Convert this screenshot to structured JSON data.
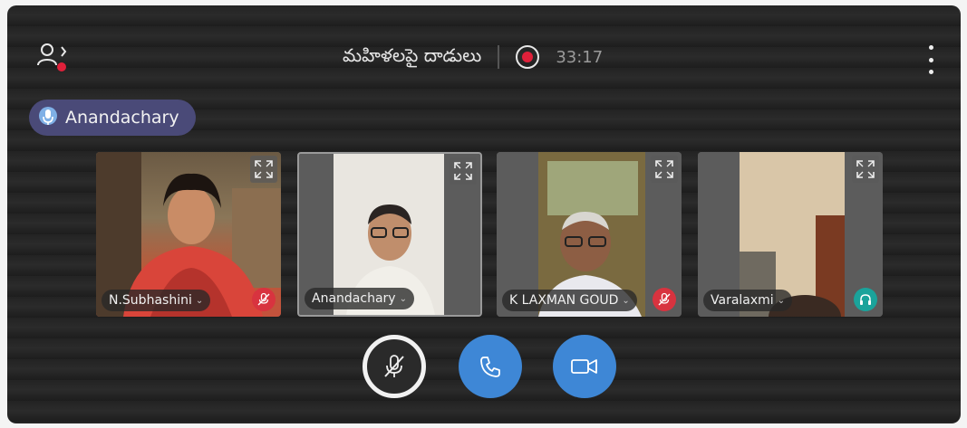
{
  "header": {
    "meeting_title": "మహిళలపై దాడులు",
    "timer": "33:17",
    "recording": true
  },
  "active_speaker": {
    "name": "Anandachary"
  },
  "participants": [
    {
      "name": "N.Subhashini",
      "status_icon": "mic-muted-icon"
    },
    {
      "name": "Anandachary",
      "status_icon": ""
    },
    {
      "name": "K LAXMAN GOUD",
      "status_icon": "mic-muted-icon"
    },
    {
      "name": "Varalaxmi",
      "status_icon": "headset-icon"
    }
  ],
  "controls": {
    "mic": "mic-muted-icon",
    "call": "phone-icon",
    "video": "video-camera-icon"
  },
  "colors": {
    "accent_blue": "#3e87d6",
    "record_red": "#e0203a",
    "muted_red": "#d8333f",
    "headset_teal": "#1aa39b",
    "speaker_chip": "#4a4a78"
  }
}
